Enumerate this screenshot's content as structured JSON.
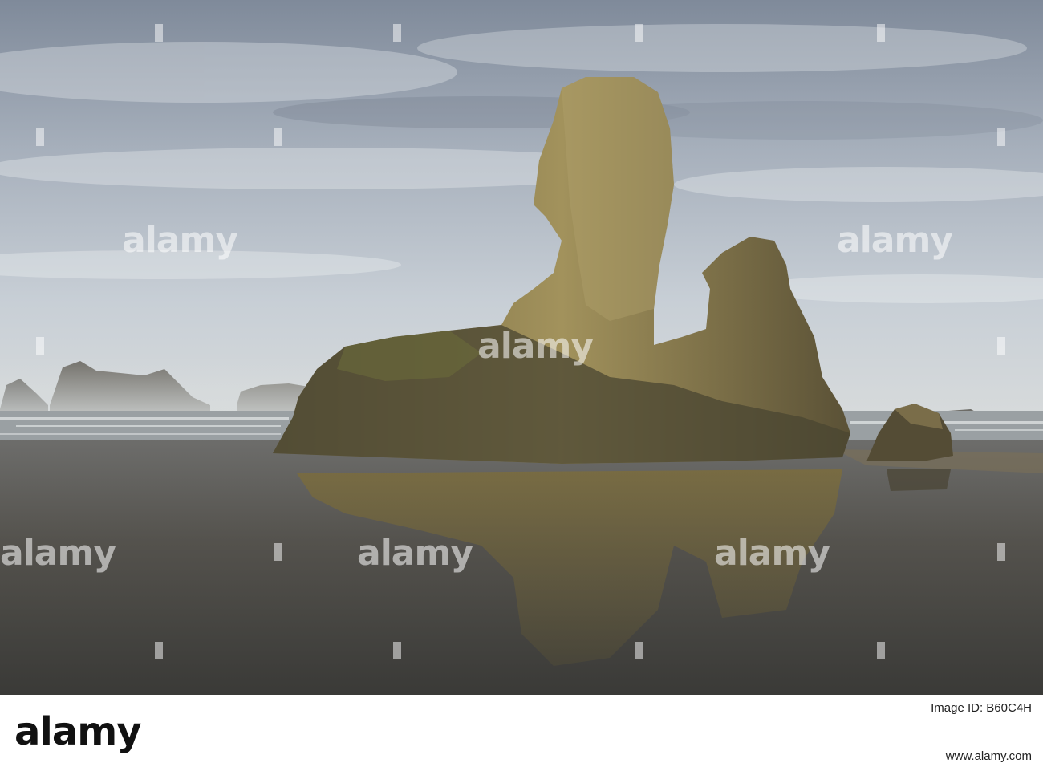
{
  "watermark": {
    "text": "alamy"
  },
  "footer": {
    "logo": "alamy",
    "image_id": "Image ID: B60C4H",
    "site": "www.alamy.com"
  },
  "colors": {
    "sky_top": "#8e98a6",
    "sky_bottom": "#c9d1d8",
    "rock_lit": "#9a8a55",
    "rock_shadow": "#3d382a",
    "wet_sand": "#5b5a55",
    "footer_bg": "#ffffff"
  }
}
